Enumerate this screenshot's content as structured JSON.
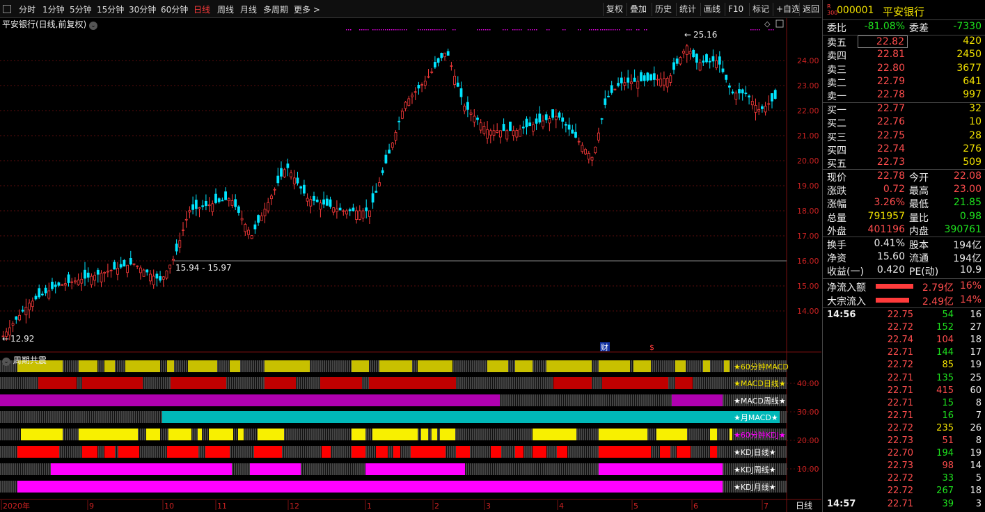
{
  "toolbar": {
    "periods": [
      "分时",
      "1分钟",
      "5分钟",
      "15分钟",
      "30分钟",
      "60分钟",
      "日线",
      "周线",
      "月线",
      "多周期",
      "更多"
    ],
    "active": "日线",
    "right_buttons": [
      "复权",
      "叠加",
      "历史",
      "统计",
      "画线",
      "F10",
      "标记",
      "+自选",
      "返回"
    ]
  },
  "chart": {
    "title": "平安银行(日线,前复权)",
    "high_label": "25.16",
    "low_label": "12.92",
    "range_label": "15.94 - 15.97",
    "y_ticks": [
      "24.00",
      "23.00",
      "22.00",
      "21.00",
      "20.00",
      "19.00",
      "18.00",
      "17.00",
      "16.00",
      "15.00",
      "14.00"
    ],
    "marker_cai": "财",
    "marker_s": "$"
  },
  "indicator": {
    "title": "周期共震",
    "rows": [
      {
        "label": "★60分钟MACD",
        "color": "#c8c000"
      },
      {
        "label": "★MACD日线★",
        "color": "#c00000"
      },
      {
        "label": "★MACD周线★",
        "color": "#b000b0"
      },
      {
        "label": "★月MACD★",
        "color": "#00b8b8"
      },
      {
        "label": "★60分钟KDJ★",
        "color": "#f8f000"
      },
      {
        "label": "★KDJ日线★",
        "color": "#ff0000"
      },
      {
        "label": "★KDJ周线★",
        "color": "#ff00ff"
      },
      {
        "label": "★KDJ月线★",
        "color": "#ff00ff"
      }
    ],
    "y_ticks": [
      "40.00",
      "30.00",
      "20.00",
      "10.00"
    ]
  },
  "x_axis": [
    "2020年",
    "9",
    "10",
    "11",
    "12",
    "1",
    "2",
    "3",
    "4",
    "5",
    "6",
    "7"
  ],
  "x_axis_right": "日线",
  "quote": {
    "code": "000001",
    "name": "平安银行",
    "badge": "R\n300",
    "weibi_label": "委比",
    "weibi": "-81.08%",
    "weicha_label": "委差",
    "weicha": "-7330",
    "sell": [
      {
        "l": "卖五",
        "p": "22.82",
        "v": "420"
      },
      {
        "l": "卖四",
        "p": "22.81",
        "v": "2450"
      },
      {
        "l": "卖三",
        "p": "22.80",
        "v": "3677"
      },
      {
        "l": "卖二",
        "p": "22.79",
        "v": "641"
      },
      {
        "l": "卖一",
        "p": "22.78",
        "v": "997"
      }
    ],
    "buy": [
      {
        "l": "买一",
        "p": "22.77",
        "v": "32"
      },
      {
        "l": "买二",
        "p": "22.76",
        "v": "10"
      },
      {
        "l": "买三",
        "p": "22.75",
        "v": "28"
      },
      {
        "l": "买四",
        "p": "22.74",
        "v": "276"
      },
      {
        "l": "买五",
        "p": "22.73",
        "v": "509"
      }
    ],
    "stats": [
      {
        "a": "现价",
        "av": "22.78",
        "ac": "red",
        "b": "今开",
        "bv": "22.08",
        "bc": "red"
      },
      {
        "a": "涨跌",
        "av": "0.72",
        "ac": "red",
        "b": "最高",
        "bv": "23.00",
        "bc": "red"
      },
      {
        "a": "涨幅",
        "av": "3.26%",
        "ac": "red",
        "b": "最低",
        "bv": "21.85",
        "bc": "green"
      },
      {
        "a": "总量",
        "av": "791957",
        "ac": "yellow",
        "b": "量比",
        "bv": "0.98",
        "bc": "green"
      },
      {
        "a": "外盘",
        "av": "401196",
        "ac": "red",
        "b": "内盘",
        "bv": "390761",
        "bc": "green"
      }
    ],
    "stats2": [
      {
        "a": "换手",
        "av": "0.41%",
        "b": "股本",
        "bv": "194亿"
      },
      {
        "a": "净资",
        "av": "15.60",
        "b": "流通",
        "bv": "194亿"
      },
      {
        "a": "收益(一)",
        "av": "0.420",
        "b": "PE(动)",
        "bv": "10.9"
      }
    ],
    "flow": [
      {
        "l": "净流入额",
        "v": "2.79亿",
        "p": "16%"
      },
      {
        "l": "大宗流入",
        "v": "2.49亿",
        "p": "14%"
      }
    ],
    "ticks": [
      {
        "t": "14:56",
        "p": "22.75",
        "v": "54",
        "vc": "green",
        "n": "16"
      },
      {
        "t": "",
        "p": "22.72",
        "v": "152",
        "vc": "green",
        "n": "27"
      },
      {
        "t": "",
        "p": "22.74",
        "v": "104",
        "vc": "red",
        "n": "18"
      },
      {
        "t": "",
        "p": "22.71",
        "v": "144",
        "vc": "green",
        "n": "17"
      },
      {
        "t": "",
        "p": "22.72",
        "v": "85",
        "vc": "yellow",
        "n": "19"
      },
      {
        "t": "",
        "p": "22.71",
        "v": "135",
        "vc": "green",
        "n": "25"
      },
      {
        "t": "",
        "p": "22.71",
        "v": "415",
        "vc": "red",
        "n": "60"
      },
      {
        "t": "",
        "p": "22.71",
        "v": "15",
        "vc": "green",
        "n": "8"
      },
      {
        "t": "",
        "p": "22.71",
        "v": "16",
        "vc": "green",
        "n": "7"
      },
      {
        "t": "",
        "p": "22.72",
        "v": "235",
        "vc": "yellow",
        "n": "26"
      },
      {
        "t": "",
        "p": "22.73",
        "v": "51",
        "vc": "red",
        "n": "8"
      },
      {
        "t": "",
        "p": "22.70",
        "v": "194",
        "vc": "green",
        "n": "19"
      },
      {
        "t": "",
        "p": "22.73",
        "v": "98",
        "vc": "red",
        "n": "14"
      },
      {
        "t": "",
        "p": "22.72",
        "v": "33",
        "vc": "green",
        "n": "5"
      },
      {
        "t": "",
        "p": "22.72",
        "v": "267",
        "vc": "green",
        "n": "18"
      },
      {
        "t": "14:57",
        "p": "22.71",
        "v": "39",
        "vc": "green",
        "n": "3"
      }
    ]
  }
}
